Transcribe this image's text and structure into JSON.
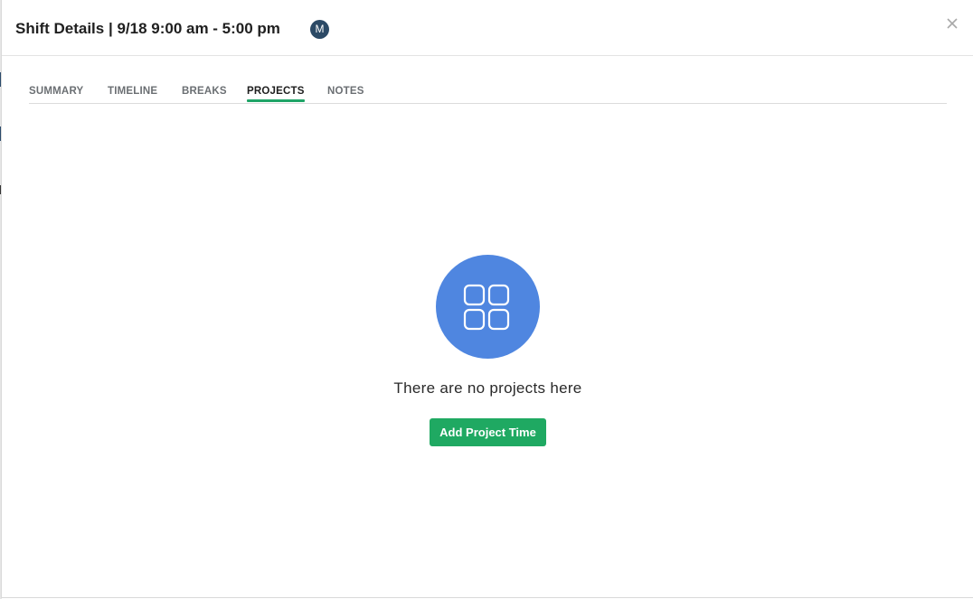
{
  "modal": {
    "title": "Shift Details | 9/18 9:00 am - 5:00 pm",
    "avatar_initial": "M",
    "close_icon": "close-icon"
  },
  "tabs": [
    {
      "label": "SUMMARY",
      "active": false
    },
    {
      "label": "TIMELINE",
      "active": false
    },
    {
      "label": "BREAKS",
      "active": false
    },
    {
      "label": "PROJECTS",
      "active": true
    },
    {
      "label": "NOTES",
      "active": false
    }
  ],
  "empty_state": {
    "icon": "grid-icon",
    "message": "There are no projects here",
    "button_label": "Add Project Time"
  },
  "colors": {
    "accent_green": "#1fa962",
    "icon_blue": "#4f86e0",
    "avatar_navy": "#2c4a66"
  }
}
